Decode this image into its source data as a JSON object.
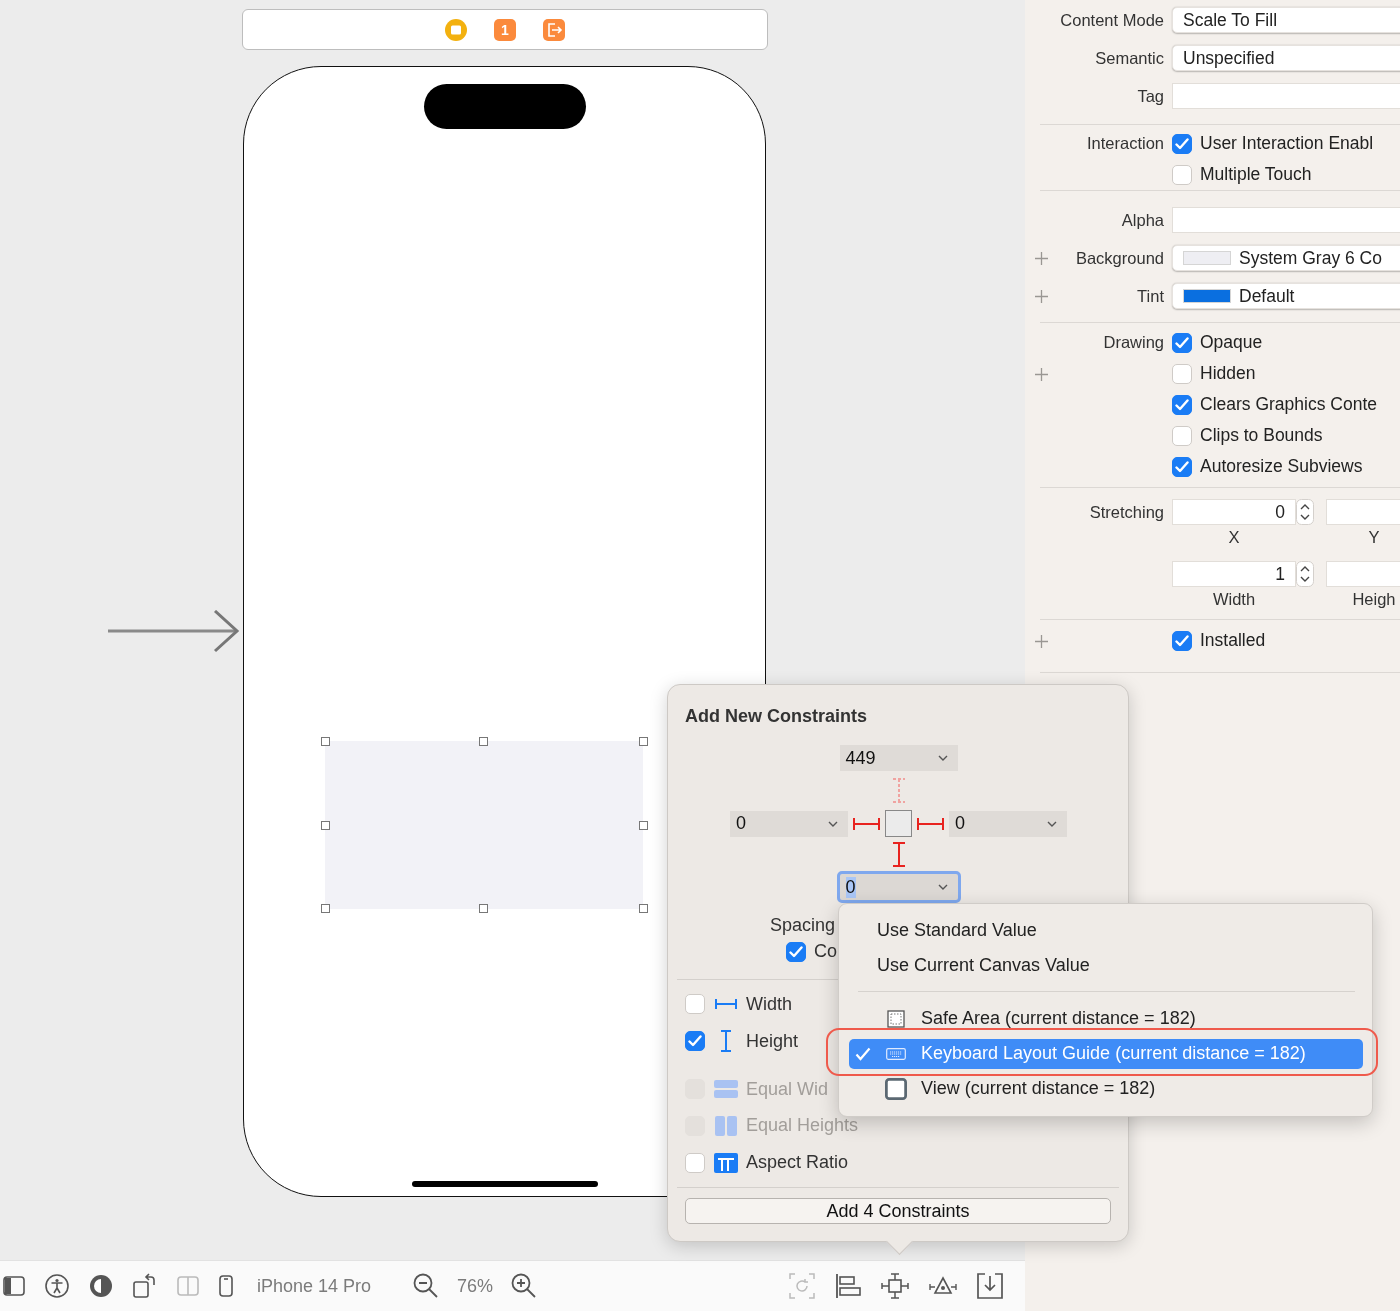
{
  "scene_dock": {
    "badge": "1"
  },
  "canvas": {
    "view_selected": true
  },
  "popover": {
    "title": "Add New Constraints",
    "top": {
      "value": "449",
      "pinned": false
    },
    "leading": {
      "value": "0",
      "pinned": true
    },
    "trailing": {
      "value": "0",
      "pinned": true
    },
    "bottom": {
      "value": "0",
      "pinned": true,
      "focused": true
    },
    "spacing_label": "Spacing",
    "constrain": {
      "text": "Co",
      "checked": true
    },
    "options": [
      {
        "kind": "width",
        "text": "Width",
        "checked": false,
        "disabled": false
      },
      {
        "kind": "height",
        "text": "Height",
        "checked": true,
        "disabled": false
      },
      {
        "kind": "equal_widths",
        "text": "Equal Wid",
        "checked": false,
        "disabled": true
      },
      {
        "kind": "equal_heights",
        "text": "Equal Heights",
        "checked": false,
        "disabled": true
      },
      {
        "kind": "aspect_ratio",
        "text": "Aspect Ratio",
        "checked": false,
        "disabled": false
      }
    ],
    "button": "Add 4 Constraints"
  },
  "menu": {
    "actions": [
      "Use Standard Value",
      "Use Current Canvas Value"
    ],
    "targets": [
      {
        "kind": "safe_area",
        "text": "Safe Area (current distance = 182)",
        "selected": false
      },
      {
        "kind": "keyboard_guide",
        "text": "Keyboard Layout Guide (current distance = 182)",
        "selected": true
      },
      {
        "kind": "view",
        "text": "View (current distance = 182)",
        "selected": false
      }
    ]
  },
  "inspector": {
    "sections": [
      {
        "rows": [
          {
            "kind": "popup",
            "label": "Content Mode",
            "value": "Scale To Fill"
          },
          {
            "kind": "popup",
            "label": "Semantic",
            "value": "Unspecified"
          },
          {
            "kind": "field",
            "label": "Tag"
          }
        ]
      },
      {
        "rows": [
          {
            "kind": "check",
            "label": "Interaction",
            "text": "User Interaction Enabl",
            "checked": true
          },
          {
            "kind": "check",
            "text": "Multiple Touch",
            "checked": false
          }
        ]
      },
      {
        "rows": [
          {
            "kind": "field",
            "label": "Alpha"
          },
          {
            "kind": "color",
            "label": "Background",
            "value": "System Gray 6 Co",
            "color": "#eeeef3",
            "plus": true
          },
          {
            "kind": "color",
            "label": "Tint",
            "value": "Default",
            "color": "#0a6fe0",
            "plus": true
          }
        ]
      },
      {
        "rows": [
          {
            "kind": "check",
            "label": "Drawing",
            "text": "Opaque",
            "checked": true
          },
          {
            "kind": "check",
            "text": "Hidden",
            "checked": false,
            "plus": true
          },
          {
            "kind": "check",
            "text": "Clears Graphics Conte",
            "checked": true
          },
          {
            "kind": "check",
            "text": "Clips to Bounds",
            "checked": false
          },
          {
            "kind": "check",
            "text": "Autoresize Subviews",
            "checked": true
          }
        ]
      },
      {
        "rows": [
          {
            "kind": "stretch",
            "label": "Stretching",
            "fields": [
              {
                "value": "0",
                "caption": "X",
                "stepper": true
              },
              {
                "caption": "Y",
                "stepper": false
              }
            ]
          },
          {
            "kind": "stretch",
            "fields": [
              {
                "value": "1",
                "caption": "Width",
                "stepper": true
              },
              {
                "caption": "Heigh",
                "stepper": false
              }
            ]
          }
        ]
      },
      {
        "rows": [
          {
            "kind": "check",
            "text": "Installed",
            "checked": true,
            "plus": true
          }
        ]
      }
    ]
  },
  "bottom_bar": {
    "device": "iPhone 14 Pro",
    "zoom": "76%"
  }
}
